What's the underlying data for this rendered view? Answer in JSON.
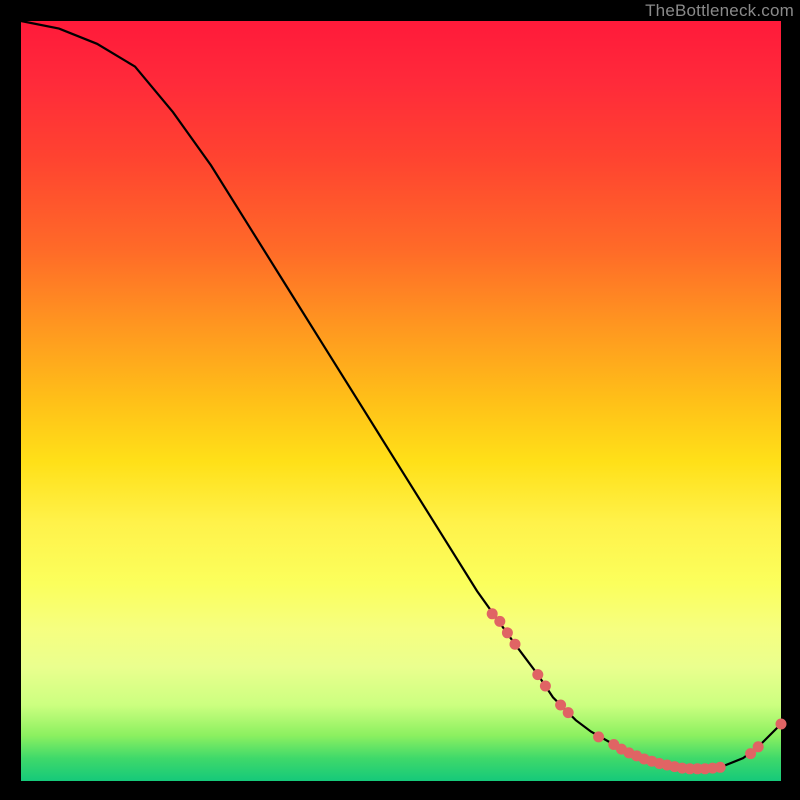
{
  "watermark": "TheBottleneck.com",
  "chart_data": {
    "type": "line",
    "title": "",
    "xlabel": "",
    "ylabel": "",
    "xlim": [
      0,
      100
    ],
    "ylim": [
      0,
      100
    ],
    "series": [
      {
        "name": "curve",
        "x": [
          0,
          5,
          10,
          15,
          20,
          25,
          30,
          35,
          40,
          45,
          50,
          55,
          60,
          65,
          68,
          70,
          73,
          75,
          78,
          80,
          82,
          84,
          86,
          88,
          90,
          92,
          95,
          97,
          100
        ],
        "values": [
          100,
          99,
          97,
          94,
          88,
          81,
          73,
          65,
          57,
          49,
          41,
          33,
          25,
          18,
          14,
          11,
          8,
          6.5,
          4.8,
          3.7,
          2.9,
          2.3,
          1.9,
          1.6,
          1.6,
          1.8,
          3.0,
          4.5,
          7.5
        ]
      }
    ],
    "markers": [
      {
        "x": 62,
        "y": 22
      },
      {
        "x": 63,
        "y": 21
      },
      {
        "x": 64,
        "y": 19.5
      },
      {
        "x": 65,
        "y": 18
      },
      {
        "x": 68,
        "y": 14
      },
      {
        "x": 69,
        "y": 12.5
      },
      {
        "x": 71,
        "y": 10
      },
      {
        "x": 72,
        "y": 9
      },
      {
        "x": 76,
        "y": 5.8
      },
      {
        "x": 78,
        "y": 4.8
      },
      {
        "x": 79,
        "y": 4.2
      },
      {
        "x": 80,
        "y": 3.7
      },
      {
        "x": 81,
        "y": 3.3
      },
      {
        "x": 82,
        "y": 2.9
      },
      {
        "x": 83,
        "y": 2.6
      },
      {
        "x": 84,
        "y": 2.3
      },
      {
        "x": 85,
        "y": 2.1
      },
      {
        "x": 86,
        "y": 1.9
      },
      {
        "x": 87,
        "y": 1.7
      },
      {
        "x": 88,
        "y": 1.6
      },
      {
        "x": 89,
        "y": 1.6
      },
      {
        "x": 90,
        "y": 1.6
      },
      {
        "x": 91,
        "y": 1.7
      },
      {
        "x": 92,
        "y": 1.8
      },
      {
        "x": 96,
        "y": 3.6
      },
      {
        "x": 97,
        "y": 4.5
      },
      {
        "x": 100,
        "y": 7.5
      }
    ],
    "marker_color": "#e06464"
  }
}
